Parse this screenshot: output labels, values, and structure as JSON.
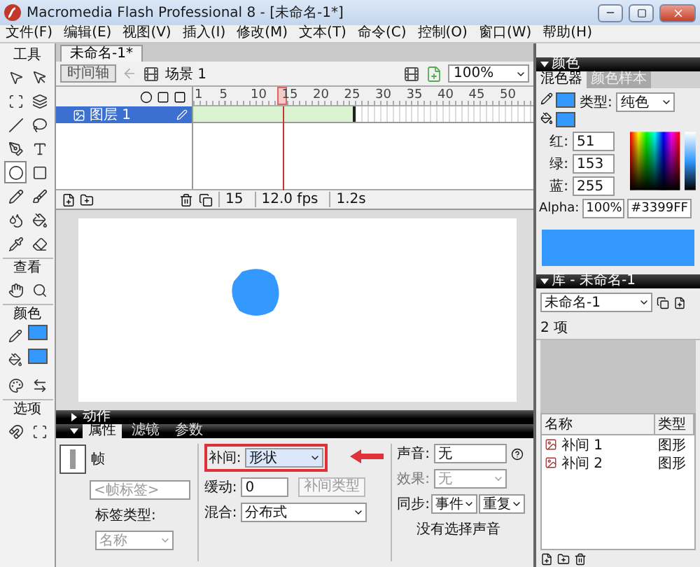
{
  "window": {
    "title": "Macromedia Flash Professional 8 - [未命名-1*]"
  },
  "menu": [
    "文件(F)",
    "编辑(E)",
    "视图(V)",
    "插入(I)",
    "修改(M)",
    "文本(T)",
    "命令(C)",
    "控制(O)",
    "窗口(W)",
    "帮助(H)"
  ],
  "toolbox": {
    "title": "工具",
    "view_label": "查看",
    "color_label": "颜色",
    "options_label": "选项"
  },
  "document": {
    "tab": "未命名-1*",
    "timeline_button": "时间轴",
    "scene": "场景 1",
    "zoom": "100%"
  },
  "timeline": {
    "frame_numbers": [
      "1",
      "5",
      "10",
      "15",
      "20",
      "25",
      "30",
      "35",
      "40",
      "45",
      "50"
    ],
    "layers": [
      {
        "name": "图层 1",
        "selected": true,
        "kind": "shape-tween"
      }
    ],
    "current_frame": "15",
    "fps": "12.0 fps",
    "time": "1.2s"
  },
  "properties": {
    "actions": "动作",
    "tabs": [
      {
        "label": "属性",
        "selected": true
      },
      {
        "label": "滤镜",
        "selected": false
      },
      {
        "label": "参数",
        "selected": false
      }
    ],
    "frame_label": "帧",
    "frame_name_placeholder": "<帧标签>",
    "label_type_label": "标签类型:",
    "label_type": "名称",
    "tween_label": "补间:",
    "tween": "形状",
    "ease_label": "缓动:",
    "ease": "0",
    "tooltip": "补间类型",
    "blend_label": "混合:",
    "blend": "分布式",
    "sound_label": "声音:",
    "sound": "无",
    "effect_label": "效果:",
    "effect": "无",
    "sync_label": "同步:",
    "sync": "事件",
    "repeat": "重复",
    "sound_status": "没有选择声音"
  },
  "color_panel": {
    "title": "颜色",
    "tabs": [
      {
        "label": "混色器",
        "selected": true
      },
      {
        "label": "颜色样本",
        "selected": false
      }
    ],
    "type_label": "类型:",
    "type": "纯色",
    "channels": [
      {
        "label": "红:",
        "value": "51"
      },
      {
        "label": "绿:",
        "value": "153"
      },
      {
        "label": "蓝:",
        "value": "255"
      }
    ],
    "alpha_label": "Alpha:",
    "alpha": "100%",
    "hex": "#3399FF",
    "color": "#3399ff"
  },
  "library": {
    "title": "库 - 未命名-1",
    "document": "未命名-1",
    "count": "2 项",
    "columns": [
      "名称",
      "类型"
    ],
    "items": [
      {
        "name": "补间 1",
        "type": "图形"
      },
      {
        "name": "补间 2",
        "type": "图形"
      }
    ]
  }
}
